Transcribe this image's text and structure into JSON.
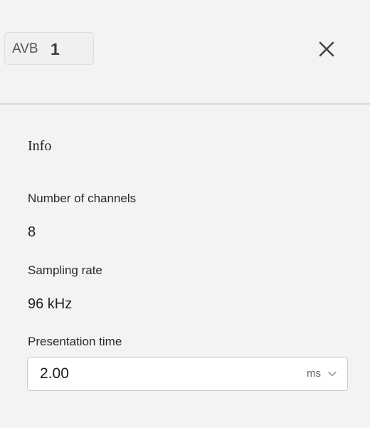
{
  "header": {
    "badge_prefix": "AVB",
    "badge_number": "1",
    "close_icon": "close-icon"
  },
  "info": {
    "title": "Info",
    "number_of_channels_label": "Number of channels",
    "number_of_channels_value": "8",
    "sampling_rate_label": "Sampling rate",
    "sampling_rate_value": "96 kHz",
    "presentation_time_label": "Presentation time",
    "presentation_time_value": "2.00",
    "presentation_time_unit": "ms",
    "dropdown_icon": "chevron-down-icon"
  },
  "colors": {
    "background": "#f3f3f3",
    "input_background": "#ffffff",
    "divider": "#d8d8d8",
    "text": "#222222",
    "muted_text": "#666666",
    "close_icon": "#444444"
  }
}
